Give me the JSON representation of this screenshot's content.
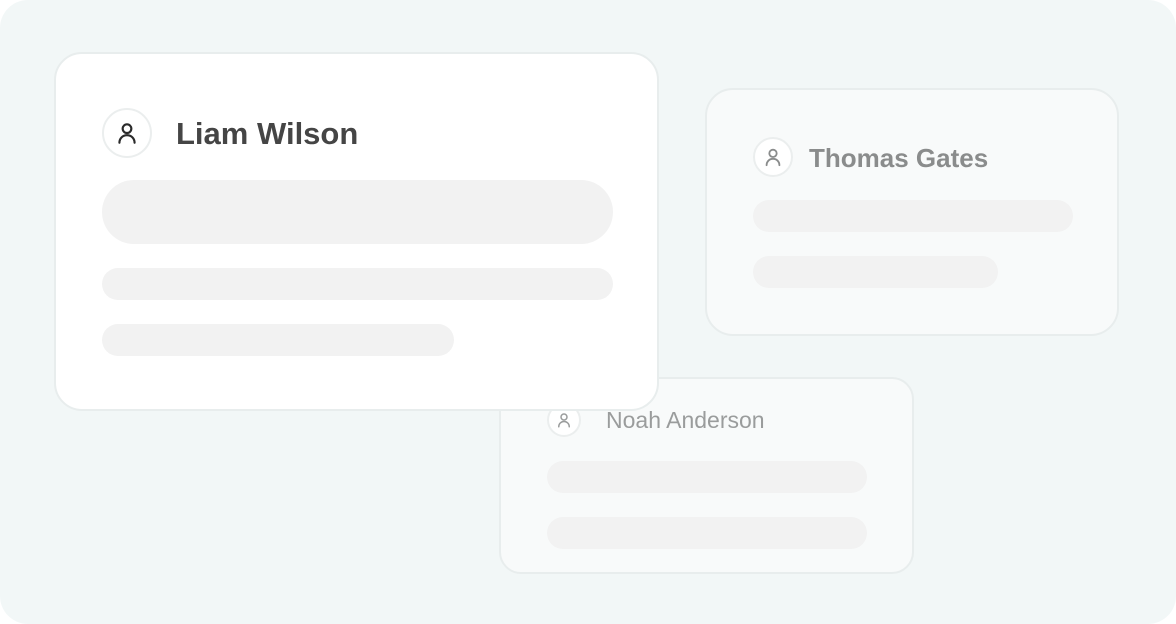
{
  "colors": {
    "background": "#f2f7f7",
    "card_front": "#ffffff",
    "card_back": "#f8fafa",
    "skeleton": "#f2f2f2"
  },
  "cards": [
    {
      "name": "Liam Wilson",
      "icon": "user-icon"
    },
    {
      "name": "Thomas Gates",
      "icon": "user-icon"
    },
    {
      "name": "Noah Anderson",
      "icon": "user-icon"
    }
  ]
}
